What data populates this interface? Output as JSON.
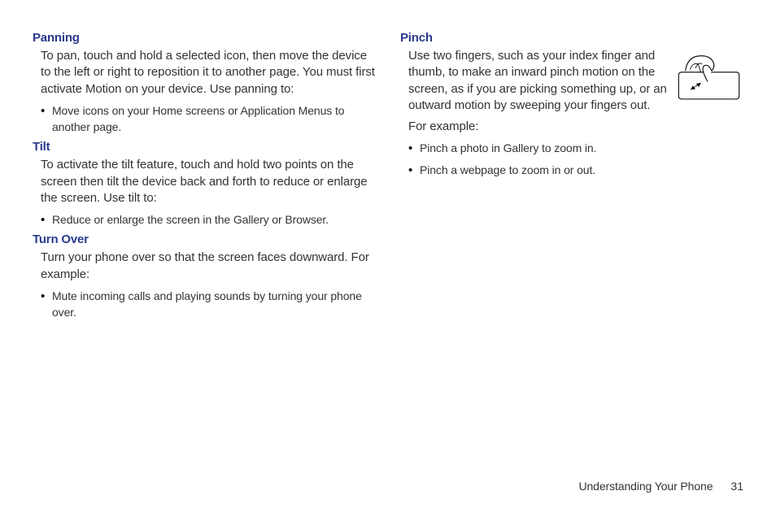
{
  "left": {
    "panning": {
      "heading": "Panning",
      "text": "To pan, touch and hold a selected icon, then move the device to the left or right to reposition it to another page. You must first activate Motion on your device. Use panning to:",
      "bullets": [
        "Move icons on your Home screens or Application Menus to another page."
      ]
    },
    "tilt": {
      "heading": "Tilt",
      "text": "To activate the tilt feature, touch and hold two points on the screen then tilt the device back and forth to reduce or enlarge the screen. Use tilt to:",
      "bullets": [
        "Reduce or enlarge the screen in the Gallery or Browser."
      ]
    },
    "turnover": {
      "heading": "Turn Over",
      "text": "Turn your phone over so that the screen faces downward. For example:",
      "bullets": [
        "Mute incoming calls and playing sounds by turning your phone over."
      ]
    }
  },
  "right": {
    "pinch": {
      "heading": "Pinch",
      "text": "Use two fingers, such as your index finger and thumb, to make an inward pinch motion on the screen, as if you are picking something up, or an outward motion by sweeping your fingers out.",
      "example_label": "For example:",
      "bullets": [
        "Pinch a photo in Gallery to zoom in.",
        "Pinch a webpage to zoom in or out."
      ]
    }
  },
  "footer": {
    "title": "Understanding Your Phone",
    "page": "31"
  }
}
